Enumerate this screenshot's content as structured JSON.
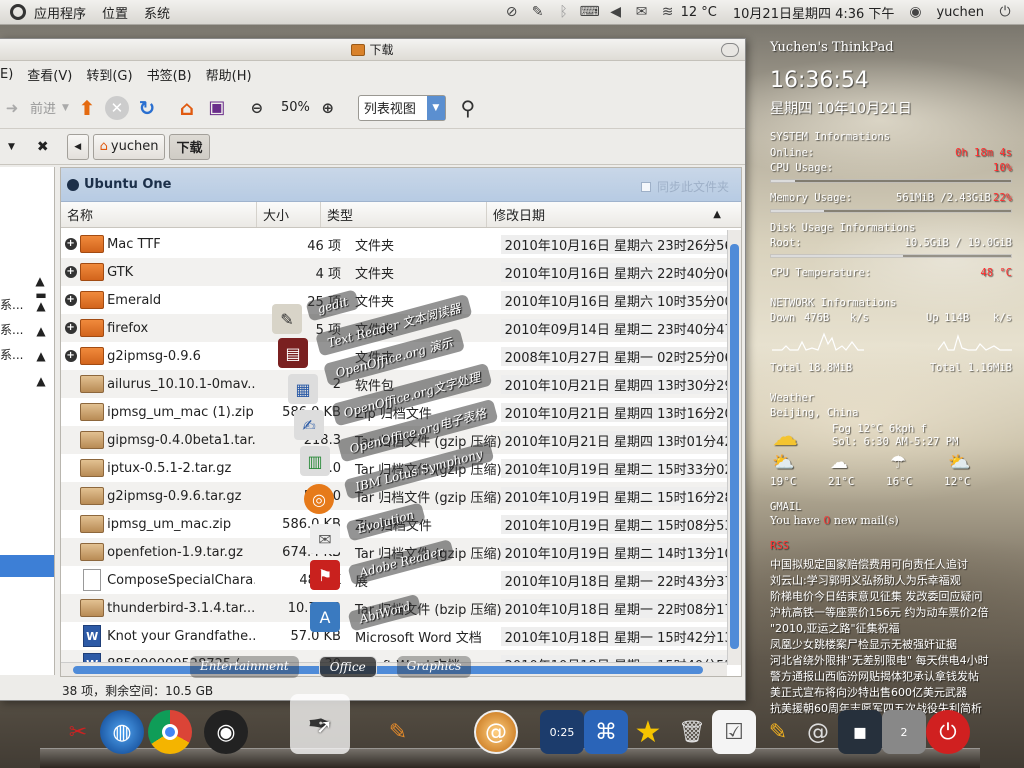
{
  "top_panel": {
    "menus": [
      "应用程序",
      "位置",
      "系统"
    ],
    "weather": "12 °C",
    "datetime": "10月21日星期四 4:36 下午",
    "user": "yuchen"
  },
  "file_manager": {
    "title": "下载",
    "menubar": [
      "E)",
      "查看(V)",
      "转到(G)",
      "书签(B)",
      "帮助(H)"
    ],
    "toolbar": {
      "forward_label": "前进",
      "zoom": "50%",
      "view_mode": "列表视图"
    },
    "path": [
      "yuchen",
      "下载"
    ],
    "ubuntu_one": {
      "title": "Ubuntu One",
      "sync_label": "同步此文件夹"
    },
    "sidebar_items": [
      "",
      "系...",
      "系...",
      "系...",
      ""
    ],
    "columns": [
      "名称",
      "大小",
      "类型",
      "修改日期"
    ],
    "files": [
      {
        "name": "Mac TTF",
        "size": "46 项",
        "type": "文件夹",
        "date": "2010年10月16日 星期六 23时26分56秒",
        "icon": "folder",
        "expand": true
      },
      {
        "name": "GTK",
        "size": "4 项",
        "type": "文件夹",
        "date": "2010年10月16日 星期六 22时40分06秒",
        "icon": "folder",
        "expand": true
      },
      {
        "name": "Emerald",
        "size": "25 项",
        "type": "文件夹",
        "date": "2010年10月16日 星期六 10时35分00秒",
        "icon": "folder",
        "expand": true
      },
      {
        "name": "firefox",
        "size": "5 项",
        "type": "文件夹",
        "date": "2010年09月14日 星期二 23时40分47秒",
        "icon": "folder",
        "expand": true
      },
      {
        "name": "g2ipmsg-0.9.6",
        "size": "",
        "type": "文件夹",
        "date": "2008年10月27日 星期一 02时25分06秒",
        "icon": "folder",
        "expand": true
      },
      {
        "name": "ailurus_10.10.1-0mav...",
        "size": "2",
        "type": "软件包",
        "date": "2010年10月21日 星期四 13时30分29秒",
        "icon": "archive",
        "expand": false
      },
      {
        "name": "ipmsg_um_mac (1).zip",
        "size": "586.0 KB",
        "type": "Zip 归档文件",
        "date": "2010年10月21日 星期四 13时16分20秒",
        "icon": "archive",
        "expand": false
      },
      {
        "name": "gipmsg-0.4.0beta1.tar....",
        "size": "218.3",
        "type": "Tar 归档文件 (gzip 压缩)",
        "date": "2010年10月21日 星期四 13时01分42秒",
        "icon": "archive",
        "expand": false
      },
      {
        "name": "iptux-0.5.1-2.tar.gz",
        "size": "428.0",
        "type": "Tar 归档文件 (gzip 压缩)",
        "date": "2010年10月19日 星期二 15时33分02秒",
        "icon": "archive",
        "expand": false
      },
      {
        "name": "g2ipmsg-0.9.6.tar.gz",
        "size": "509.0",
        "type": "Tar 归档文件 (gzip 压缩)",
        "date": "2010年10月19日 星期二 15时16分28秒",
        "icon": "archive",
        "expand": false
      },
      {
        "name": "ipmsg_um_mac.zip",
        "size": "586.0 KB",
        "type": "Zip 归档文件",
        "date": "2010年10月19日 星期二 15时08分53秒",
        "icon": "archive",
        "expand": false
      },
      {
        "name": "openfetion-1.9.tar.gz",
        "size": "674.4 KB",
        "type": "Tar 归档文件 (gzip 压缩)",
        "date": "2010年10月19日 星期二 14时13分10秒",
        "icon": "archive",
        "expand": false
      },
      {
        "name": "ComposeSpecialChara...",
        "size": "48.0 K",
        "type": "展",
        "date": "2010年10月18日 星期一 22时43分37秒",
        "icon": "doc",
        "expand": false
      },
      {
        "name": "thunderbird-3.1.4.tar....",
        "size": "10.7 MB",
        "type": "Tar 归档文件 (bzip 压缩)",
        "date": "2010年10月18日 星期一 22时08分17秒",
        "icon": "archive",
        "expand": false
      },
      {
        "name": "Knot your Grandfathe...",
        "size": "57.0 KB",
        "type": "Microsoft Word 文档",
        "date": "2010年10月18日 星期一 15时42分13秒",
        "icon": "word",
        "expand": false
      },
      {
        "name": "885000000528725 (...",
        "size": "30",
        "type": "rosoft Word 文档",
        "date": "2010年10月18日 星期一 15时40分52秒",
        "icon": "word",
        "expand": false
      }
    ],
    "status": "38 项，剩余空间：10.5 GB"
  },
  "conky": {
    "host": "Yuchen's ThinkPad",
    "time": "16:36:54",
    "date": "星期四 10年10月21日",
    "system_title": "SYSTEM Informations",
    "online_label": "Online:",
    "online_value": "0h 18m 4s",
    "cpu_label": "CPU Usage:",
    "cpu_value": "10%",
    "cpu_fraction": 0.1,
    "mem_label": "Memory Usage:",
    "mem_value": "561MiB /2.43GiB",
    "mem_pct": "22%",
    "mem_fraction": 0.22,
    "disk_title": "Disk Usage Informations",
    "root_label": "Root:",
    "root_value": "10.5GiB / 19.0GiB",
    "root_fraction": 0.55,
    "temp_label": "CPU Temperature:",
    "temp_value": "48 °C",
    "net_title": "NETWORK Informations",
    "down_label": "Down",
    "down_value": "476B",
    "down_unit": "k/s",
    "up_label": "Up",
    "up_value": "114B",
    "up_unit": "k/s",
    "total_down": "Total 18.8MiB",
    "total_up": "Total 1.16MiB",
    "weather_title": "Weather",
    "weather_city": "Beijing, China",
    "weather_now": "Fog    12°C    6kph f",
    "weather_sun": "Sol: 6:30 AM-5:27 PM",
    "forecast": [
      "19°C",
      "21°C",
      "16°C",
      "12°C"
    ],
    "gmail_title": "GMAIL",
    "gmail_pre": "You have",
    "gmail_count": "0",
    "gmail_post": "new mail(s)",
    "rss_title": "RSS",
    "rss": [
      "中国拟规定国家赔偿费用可向责任人追讨",
      "刘云山:学习郭明义弘扬助人为乐幸福观",
      "阶梯电价今日结束意见征集 发改委回应疑问",
      "沪杭高铁一等座票价156元 约为动车票价2倍",
      "\"2010,亚运之路\"征集祝福",
      "凤凰少女跳楼案尸检显示无被强奸证据",
      "河北省绕外限排\"无差别限电\" 每天供电4小时",
      "警方通报山西临汾网贴揭体犯承认拿钱发帖",
      "美正式宣布将向沙特出售600亿美元武器",
      "抗美援朝60周年志愿军四五次战役失利简析"
    ]
  },
  "stack": {
    "items": [
      "gedit",
      "Text Reader 文本阅读器",
      "OpenOffice.org 演示",
      "OpenOffice.org文字处理",
      "OpenOffice.org电子表格",
      "IBM Lotus Symphony",
      "Evolution",
      "Adobe Reader",
      "AbiWord"
    ],
    "categories": [
      "Entertainment",
      "Office",
      "Graphics"
    ]
  },
  "dock": {
    "clock": "0:25",
    "badge": "2"
  }
}
